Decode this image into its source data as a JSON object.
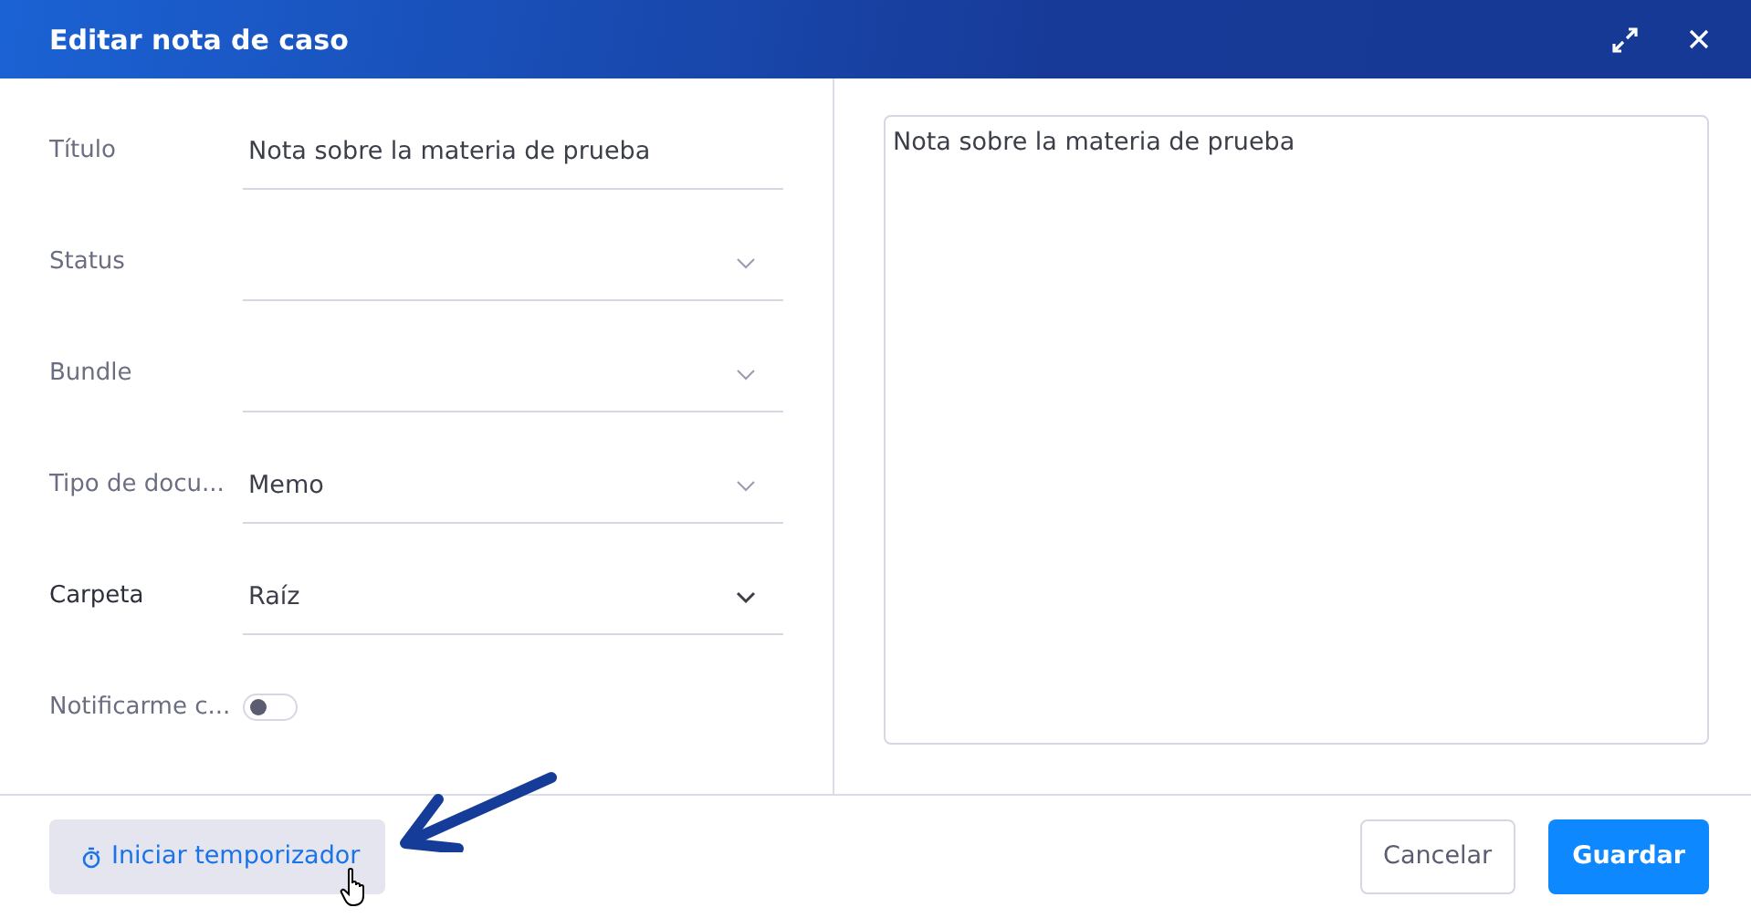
{
  "window": {
    "title": "Editar nota de caso",
    "buttons": [
      {
        "kind": "expand"
      },
      {
        "kind": "close"
      }
    ]
  },
  "fields": [
    {
      "kind": "text",
      "label": "Título",
      "value": "Nota sobre la materia de prueba",
      "emphasized": false
    },
    {
      "kind": "select",
      "label": "Status",
      "emphasized": false
    },
    {
      "kind": "select",
      "label": "Bundle",
      "emphasized": false
    },
    {
      "kind": "select",
      "label": "Tipo de docu...",
      "value": "Memo",
      "emphasized": false
    },
    {
      "kind": "select",
      "label": "Carpeta",
      "value": "Raíz",
      "emphasized": true
    },
    {
      "kind": "toggle",
      "label": "Notificarme c...",
      "on": false,
      "emphasized": false
    }
  ],
  "note": {
    "value": "Nota sobre la materia de prueba"
  },
  "footer": {
    "timer_button": "Iniciar temporizador",
    "cancel_button": "Cancelar",
    "save_button": "Guardar"
  }
}
